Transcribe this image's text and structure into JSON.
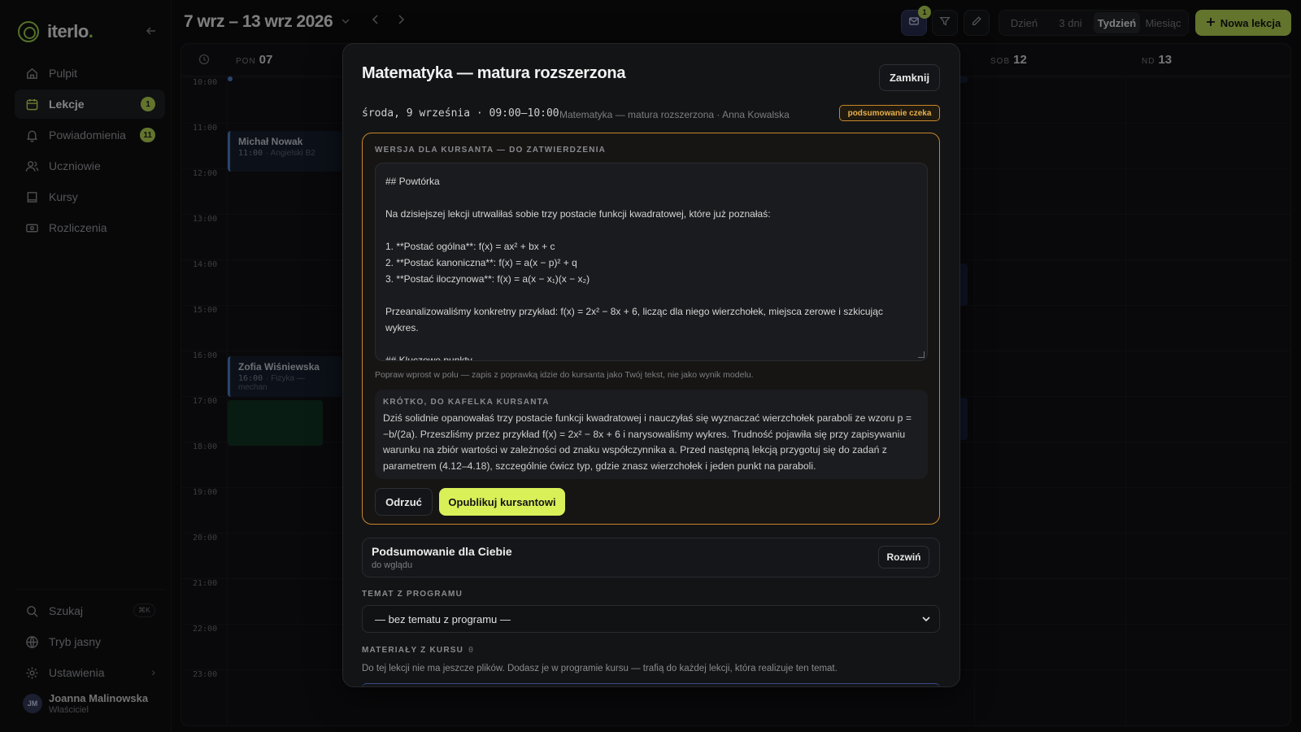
{
  "app": {
    "name": "iterlo",
    "name_dot": "."
  },
  "sidebar": {
    "items": [
      {
        "label": "Pulpit",
        "icon": "home-icon"
      },
      {
        "label": "Lekcje",
        "icon": "calendar-icon",
        "badge": "1",
        "active": true
      },
      {
        "label": "Powiadomienia",
        "icon": "bell-icon",
        "badge": "11"
      },
      {
        "label": "Uczniowie",
        "icon": "users-icon"
      },
      {
        "label": "Kursy",
        "icon": "book-icon"
      },
      {
        "label": "Rozliczenia",
        "icon": "billing-icon"
      }
    ],
    "bottom": {
      "search": "Szukaj",
      "search_kbd": "⌘K",
      "theme": "Tryb jasny",
      "settings": "Ustawienia"
    },
    "user": {
      "initials": "JM",
      "name": "Joanna Malinowska",
      "role": "Właściciel"
    }
  },
  "header": {
    "date_range": "7 wrz – 13 wrz 2026",
    "mail_badge": "1",
    "views": [
      "Dzień",
      "3 dni",
      "Tydzień",
      "Miesiąc"
    ],
    "active_view": "Tydzień",
    "new_lesson": "Nowa lekcja"
  },
  "calendar": {
    "days": [
      {
        "abbr": "PON",
        "num": "07"
      },
      {
        "abbr": "SOB",
        "num": "12"
      },
      {
        "abbr": "ND",
        "num": "13"
      }
    ],
    "hours": [
      "10:00",
      "11:00",
      "12:00",
      "13:00",
      "14:00",
      "15:00",
      "16:00",
      "17:00",
      "18:00",
      "19:00",
      "20:00",
      "21:00",
      "22:00",
      "23:00"
    ],
    "events": [
      {
        "name": "Michał Nowak",
        "time": "11:00",
        "desc": "· Angielski B2"
      },
      {
        "name": "Zofia Wiśniewska",
        "time": "16:00",
        "desc": "· Fizyka — mechan"
      }
    ]
  },
  "modal": {
    "title": "Matematyka — matura rozszerzona",
    "close": "Zamknij",
    "meta": "środa, 9 września · 09:00–10:00",
    "meta_sub": "Matematyka — matura rozszerzona · Anna Kowalska",
    "status": "podsumowanie czeka",
    "review": {
      "caption": "WERSJA DLA KURSANTA — DO ZATWIERDZENIA",
      "lines": [
        "## Powtórka",
        "",
        "Na dzisiejszej lekcji utrwaliłaś sobie trzy postacie funkcji kwadratowej, które już poznałaś:",
        "",
        "1. **Postać ogólna**: f(x) = ax² + bx + c",
        "2. **Postać kanoniczna**: f(x) = a(x − p)² + q",
        "3. **Postać iloczynowa**: f(x) = a(x − x₁)(x − x₂)",
        "",
        "Przeanalizowaliśmy konkretny przykład: f(x) = 2x² − 8x + 6, licząc dla niego wierzchołek, miejsca zerowe i szkicując wykres.",
        "",
        "## Kluczowe punkty"
      ],
      "hint": "Popraw wprost w polu — zapis z poprawką idzie do kursanta jako Twój tekst, nie jako wynik modelu.",
      "short_caption": "KRÓTKO, DO KAFELKA KURSANTA",
      "short_text": "Dziś solidnie opanowałaś trzy postacie funkcji kwadratowej i nauczyłaś się wyznaczać wierzchołek paraboli ze wzoru p = −b/(2a). Przeszliśmy przez przykład f(x) = 2x² − 8x + 6 i narysowaliśmy wykres. Trudność pojawiła się przy zapisywaniu warunku na zbiór wartości w zależności od znaku współczynnika a. Przed następną lekcją przygotuj się do zadań z parametrem (4.12–4.18), szczególnie ćwicz typ, gdzie znasz wierzchołek i jeden punkt na paraboli.",
      "reject": "Odrzuć",
      "publish": "Opublikuj kursantowi"
    },
    "summary": {
      "title": "Podsumowanie dla Ciebie",
      "sub": "do wglądu",
      "expand": "Rozwiń"
    },
    "topic": {
      "caption": "TEMAT Z PROGRAMU",
      "value": "— bez tematu z programu —"
    },
    "materials": {
      "caption": "MATERIAŁY Z KURSU",
      "count": "0",
      "info": "Do tej lekcji nie ma jeszcze plików. Dodasz je w programie kursu — trafią do każdej lekcji, która realizuje ten temat."
    }
  },
  "colors": {
    "accent": "#b4d452",
    "warning": "#c9862a",
    "event": "#4c7ec8"
  }
}
